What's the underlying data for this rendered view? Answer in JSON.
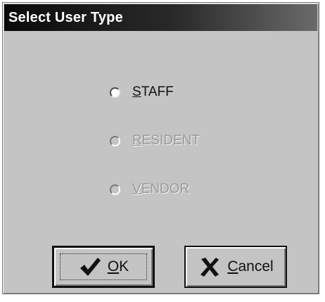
{
  "dialog": {
    "title": "Select User Type"
  },
  "options": [
    {
      "mnemonic": "S",
      "rest": "TAFF",
      "enabled": true
    },
    {
      "mnemonic": "R",
      "rest": "ESIDENT",
      "enabled": false
    },
    {
      "mnemonic": "V",
      "rest": "ENDOR",
      "enabled": false
    }
  ],
  "buttons": {
    "ok": {
      "mnemonic": "O",
      "rest": "K",
      "icon": "checkmark-icon"
    },
    "cancel": {
      "mnemonic": "C",
      "rest": "ancel",
      "icon": "x-icon"
    }
  }
}
